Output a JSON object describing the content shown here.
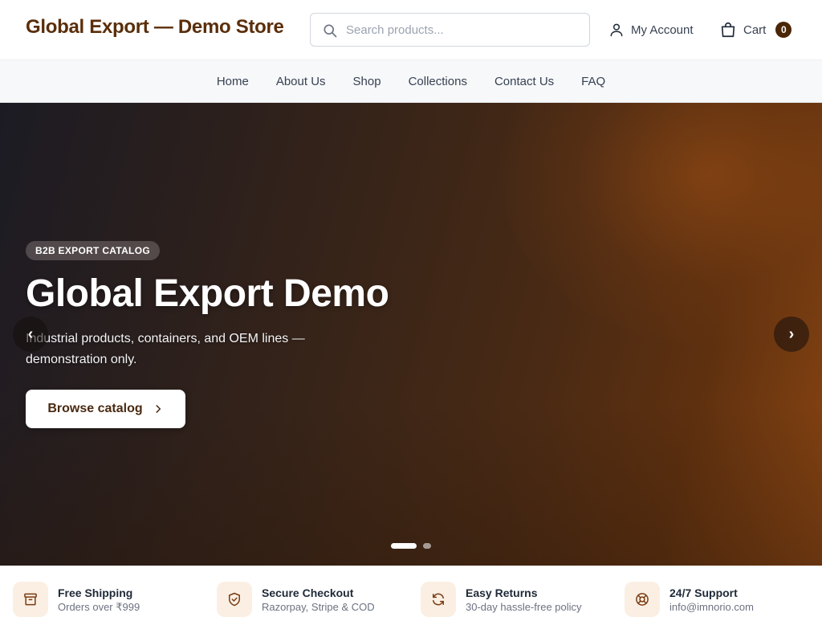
{
  "header": {
    "logo": "Global Export — Demo Store",
    "search_placeholder": "Search products...",
    "account_label": "My Account",
    "cart_label": "Cart",
    "cart_count": "0"
  },
  "nav": {
    "items": [
      {
        "label": "Home"
      },
      {
        "label": "About Us"
      },
      {
        "label": "Shop"
      },
      {
        "label": "Collections"
      },
      {
        "label": "Contact Us"
      },
      {
        "label": "FAQ"
      }
    ]
  },
  "hero": {
    "badge": "B2B EXPORT CATALOG",
    "title": "Global Export Demo",
    "subtitle": "Industrial products, containers, and OEM lines — demonstration only.",
    "cta_label": "Browse catalog",
    "prev_glyph": "‹",
    "next_glyph": "›",
    "slide_count": 2,
    "active_slide": 1
  },
  "features": [
    {
      "icon": "box-icon",
      "title": "Free Shipping",
      "desc": "Orders over ₹999"
    },
    {
      "icon": "shield-check-icon",
      "title": "Secure Checkout",
      "desc": "Razorpay, Stripe & COD"
    },
    {
      "icon": "refresh-icon",
      "title": "Easy Returns",
      "desc": "30-day hassle-free policy"
    },
    {
      "icon": "lifebuoy-icon",
      "title": "24/7 Support",
      "desc": "info@imnorio.com"
    }
  ],
  "colors": {
    "brand": "#5a2e0a",
    "cart_badge": "#4a2506",
    "feature_icon_bg": "#fbefe4",
    "feature_icon_stroke": "#7a3b10"
  }
}
